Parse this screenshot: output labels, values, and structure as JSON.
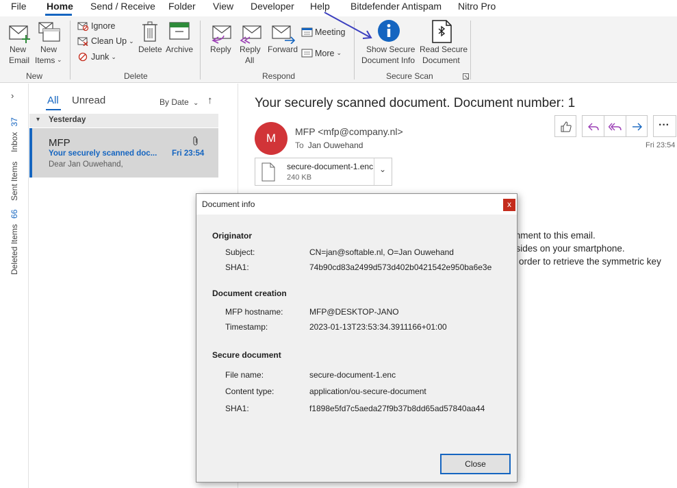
{
  "menu": {
    "tabs": [
      "File",
      "Home",
      "Send / Receive",
      "Folder",
      "View",
      "Developer",
      "Help",
      "Bitdefender Antispam",
      "Nitro Pro"
    ]
  },
  "ribbon": {
    "new_email": [
      "New",
      "Email"
    ],
    "new_items": [
      "New",
      "Items"
    ],
    "ignore": "Ignore",
    "clean_up": "Clean Up",
    "junk": "Junk",
    "delete": "Delete",
    "archive": "Archive",
    "reply": "Reply",
    "reply_all": [
      "Reply",
      "All"
    ],
    "forward": "Forward",
    "meeting": "Meeting",
    "more": "More",
    "show_secure": [
      "Show Secure",
      "Document Info"
    ],
    "read_secure": [
      "Read Secure",
      "Document"
    ],
    "groups": [
      "New",
      "Delete",
      "Respond",
      "Secure Scan"
    ]
  },
  "nav": {
    "inbox_label": "Inbox",
    "inbox_count": "37",
    "sent_label": "Sent Items",
    "deleted_label": "Deleted Items",
    "deleted_count": "66"
  },
  "list": {
    "filter_all": "All",
    "filter_unread": "Unread",
    "sort": "By Date",
    "group": "Yesterday",
    "item": {
      "from": "MFP",
      "subject": "Your securely scanned doc...",
      "time": "Fri 23:54",
      "preview": "Dear Jan Ouwehand,"
    }
  },
  "reading": {
    "subject": "Your securely scanned document. Document number: 1",
    "avatar_initial": "M",
    "sender": "MFP <mfp@company.nl>",
    "to_label": "To",
    "to": "Jan Ouwehand",
    "time": "Fri 23:54",
    "attachment": {
      "name": "secure-document-1.enc",
      "size": "240 KB"
    },
    "body": [
      "chment to this email.",
      "esides on your smartphone.",
      "order to retrieve the symmetric key"
    ]
  },
  "dialog": {
    "title": "Document info",
    "close_x": "x",
    "sections": [
      {
        "heading": "Originator",
        "rows": [
          {
            "key": "Subject:",
            "value": "CN=jan@softable.nl, O=Jan Ouwehand"
          },
          {
            "key": "SHA1:",
            "value": "74b90cd83a2499d573d402b0421542e950ba6e3e"
          }
        ]
      },
      {
        "heading": "Document creation",
        "rows": [
          {
            "key": "MFP hostname:",
            "value": "MFP@DESKTOP-JANO"
          },
          {
            "key": "Timestamp:",
            "value": "2023-01-13T23:53:34.3911166+01:00"
          }
        ]
      },
      {
        "heading": "Secure document",
        "rows": [
          {
            "key": "File name:",
            "value": "secure-document-1.enc"
          },
          {
            "key": "Content type:",
            "value": "application/ou-secure-document"
          },
          {
            "key": "SHA1:",
            "value": "f1898e5fd7c5aeda27f9b37b8dd65ad57840aa44"
          }
        ]
      }
    ],
    "close_button": "Close"
  },
  "colors": {
    "accent": "#1565c0",
    "avatar": "#d13438",
    "dialog_close": "#c42b1c",
    "secure_scan_icon": "#1565c0"
  }
}
